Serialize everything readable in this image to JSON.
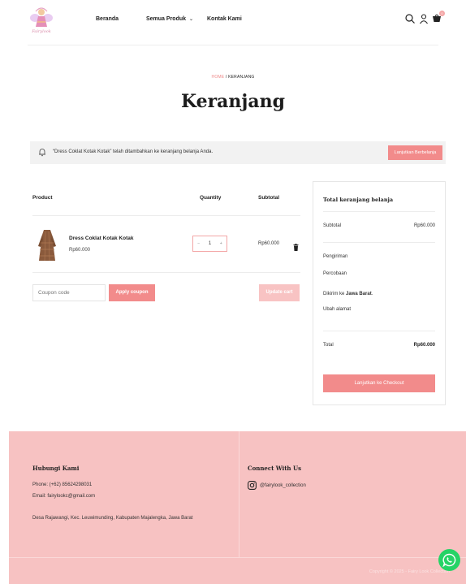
{
  "header": {
    "logo_text": "Fairylook",
    "nav": [
      {
        "label": "Beranda"
      },
      {
        "label": "Semua Produk"
      },
      {
        "label": "Kontak Kami"
      }
    ],
    "cart_count": "0"
  },
  "breadcrumb": {
    "home": "HOME",
    "separator": "/",
    "current": "KERANJANG"
  },
  "page_title": "Keranjang",
  "notice": {
    "message": "“Dress Coklat Kotak Kotak” telah ditambahkan ke keranjang belanja Anda.",
    "button": "Lanjutkan Berbelanja"
  },
  "cart": {
    "columns": {
      "product": "Product",
      "quantity": "Quantity",
      "subtotal": "Subtotal"
    },
    "items": [
      {
        "name": "Dress Coklat Kotak Kotak",
        "price": "Rp60.000",
        "quantity": "1",
        "subtotal": "Rp60.000"
      }
    ],
    "coupon_placeholder": "Coupon code",
    "apply_coupon": "Apply coupon",
    "update_cart": "Update cart"
  },
  "totals": {
    "title": "Total keranjang belanja",
    "subtotal_label": "Subtotal",
    "subtotal_value": "Rp60.000",
    "shipping_label": "Pengiriman",
    "shipping_method": "Percobaan",
    "ship_to_prefix": "Dikirim ke",
    "ship_to_region": "Jawa Barat",
    "change_address": "Ubah alamat",
    "total_label": "Total",
    "total_value": "Rp60.000",
    "checkout": "Lanjutkan ke Checkout"
  },
  "footer": {
    "contact_title": "Hubungi Kami",
    "phone": "Phone: (+62) 85624298031",
    "email": "Email: fairylookc@gmail.com",
    "address": "Desa Rajawangi, Kec. Leuwimunding, Kabupaten Majalengka, Jawa Barat",
    "connect_title": "Connect With Us",
    "instagram": "@fairylook_collection",
    "copyright": "Copyright © 2025 - Fairy Look Collection"
  },
  "colors": {
    "accent": "#f28b8b",
    "accent_light": "#f8c3c3",
    "footer_bg": "#f7c2c2",
    "whatsapp": "#25d366"
  },
  "icons": [
    "search-icon",
    "user-icon",
    "cart-icon",
    "bell-icon",
    "trash-icon",
    "instagram-icon",
    "whatsapp-icon"
  ]
}
